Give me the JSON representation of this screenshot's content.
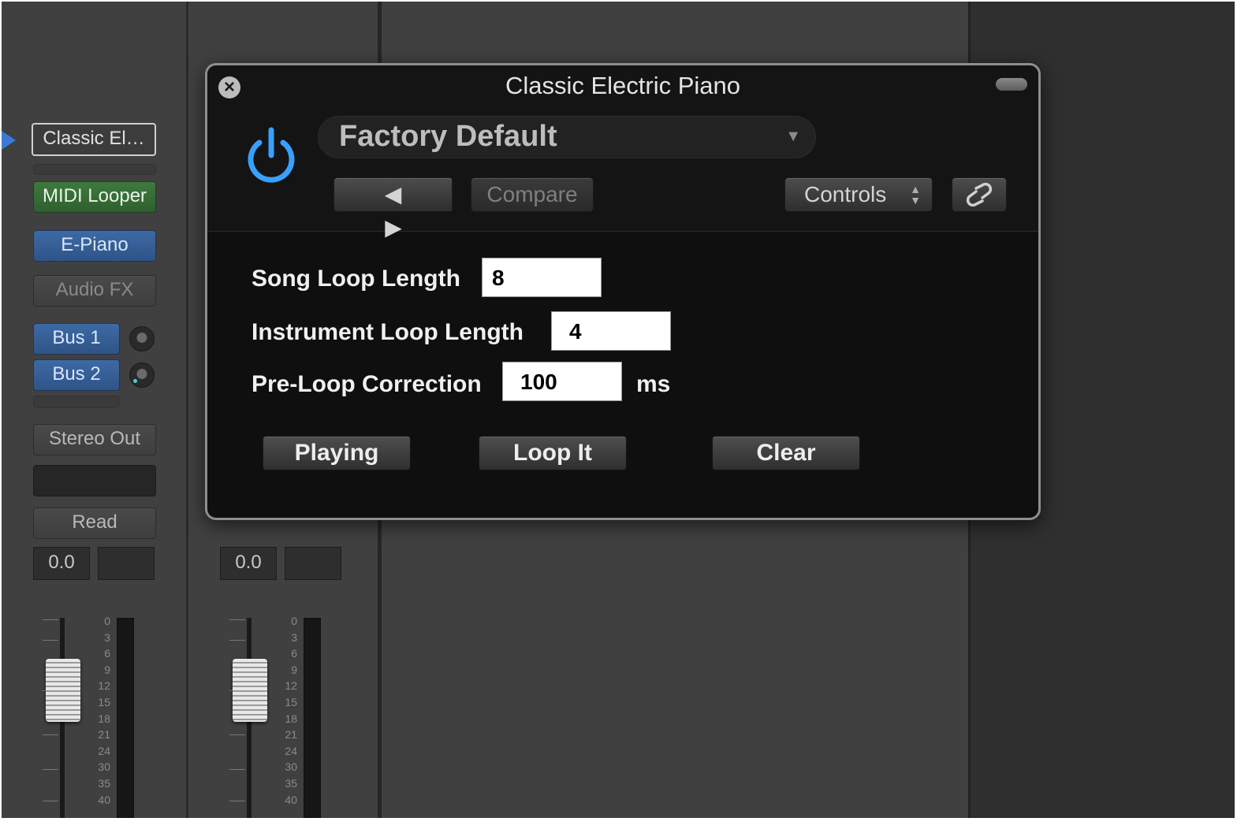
{
  "mixer": {
    "strip1": {
      "name_slot": "Classic El…",
      "midi_fx": "MIDI Looper",
      "instrument": "E-Piano",
      "audio_fx": "Audio FX",
      "sends": [
        "Bus 1",
        "Bus 2"
      ],
      "output": "Stereo Out",
      "automation": "Read",
      "volume": "0.0"
    },
    "strip2": {
      "volume": "0.0"
    },
    "meter_scale": [
      "0",
      "3",
      "6",
      "9",
      "12",
      "15",
      "18",
      "21",
      "24",
      "30",
      "35",
      "40"
    ]
  },
  "plugin": {
    "title": "Classic Electric Piano",
    "preset": "Factory Default",
    "compare_label": "Compare",
    "view_label": "Controls",
    "params": [
      {
        "label": "Song Loop Length",
        "value": "8",
        "unit": ""
      },
      {
        "label": "Instrument Loop Length",
        "value": "4",
        "unit": ""
      },
      {
        "label": "Pre-Loop Correction",
        "value": "100",
        "unit": "ms"
      }
    ],
    "actions": [
      "Playing",
      "Loop It",
      "Clear"
    ]
  },
  "colors": {
    "power_accent": "#3aa0ff",
    "midi_slot": "#3f7a3f",
    "instrument_slot": "#3d6aa5"
  },
  "icons": {
    "close": "close-circle-icon",
    "power": "power-icon",
    "prev": "triangle-left-icon",
    "next": "triangle-right-icon",
    "link": "link-icon",
    "dropdown": "chevron-down-icon",
    "stepper": "up-down-arrows-icon"
  }
}
